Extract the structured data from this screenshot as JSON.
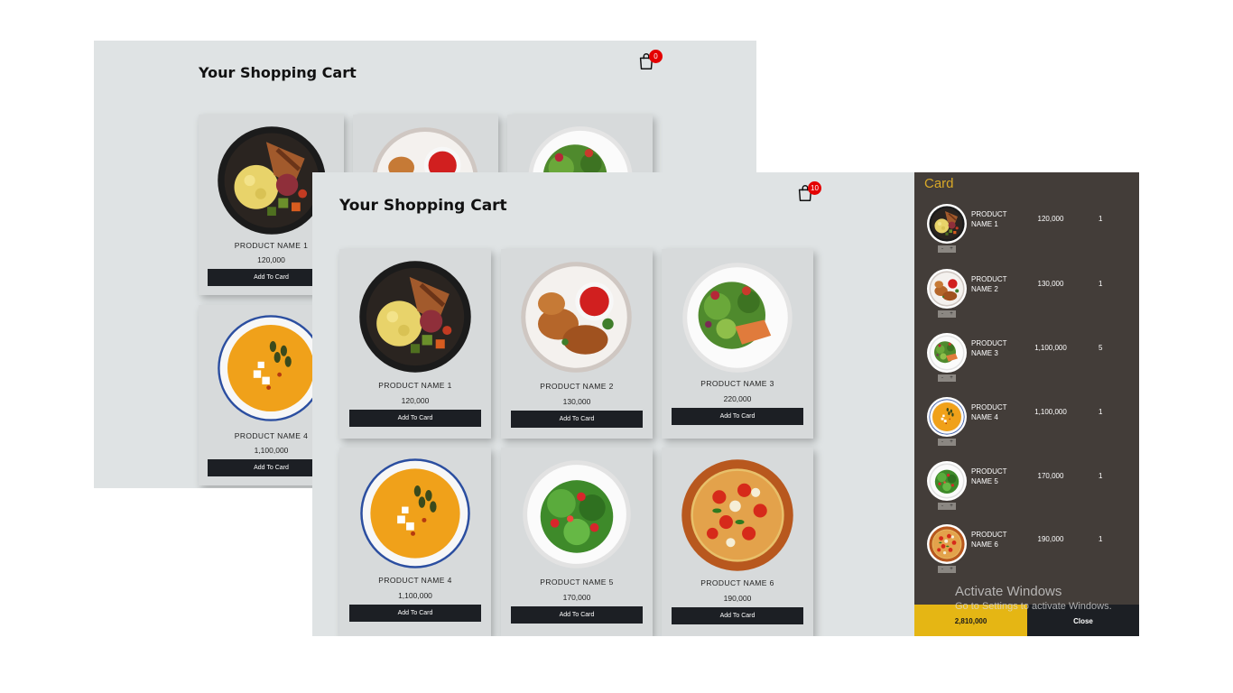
{
  "back_window": {
    "title": "Your Shopping Cart",
    "cart_count": "0",
    "products": [
      {
        "name": "PRODUCT NAME 1",
        "price": "120,000",
        "button": "Add To Card"
      },
      {
        "name": "PRODUCT NAME 4",
        "price": "1,100,000",
        "button": "Add To Card"
      }
    ]
  },
  "front_window": {
    "title": "Your Shopping Cart",
    "cart_count": "10",
    "products": [
      {
        "name": "PRODUCT NAME 1",
        "price": "120,000",
        "button": "Add To Card",
        "image": "bowl-icon"
      },
      {
        "name": "PRODUCT NAME 2",
        "price": "130,000",
        "button": "Add To Card",
        "image": "chicken-plate-icon"
      },
      {
        "name": "PRODUCT NAME 3",
        "price": "220,000",
        "button": "Add To Card",
        "image": "salmon-salad-icon"
      },
      {
        "name": "PRODUCT NAME 4",
        "price": "1,100,000",
        "button": "Add To Card",
        "image": "soup-icon"
      },
      {
        "name": "PRODUCT NAME 5",
        "price": "170,000",
        "button": "Add To Card",
        "image": "green-salad-icon"
      },
      {
        "name": "PRODUCT NAME 6",
        "price": "190,000",
        "button": "Add To Card",
        "image": "pizza-icon"
      }
    ]
  },
  "sidebar": {
    "title": "Card",
    "items": [
      {
        "name": "PRODUCT NAME 1",
        "price": "120,000",
        "qty": "1",
        "minus": "-",
        "plus": "+"
      },
      {
        "name": "PRODUCT NAME 2",
        "price": "130,000",
        "qty": "1",
        "minus": "-",
        "plus": "+"
      },
      {
        "name": "PRODUCT NAME 3",
        "price": "1,100,000",
        "qty": "5",
        "minus": "-",
        "plus": "+"
      },
      {
        "name": "PRODUCT NAME 4",
        "price": "1,100,000",
        "qty": "1",
        "minus": "-",
        "plus": "+"
      },
      {
        "name": "PRODUCT NAME 5",
        "price": "170,000",
        "qty": "1",
        "minus": "-",
        "plus": "+"
      },
      {
        "name": "PRODUCT NAME 6",
        "price": "190,000",
        "qty": "1",
        "minus": "-",
        "plus": "+"
      }
    ],
    "total": "2,810,000",
    "close_label": "Close"
  },
  "watermark": {
    "line1": "Activate Windows",
    "line2": "Go to Settings to activate Windows."
  },
  "colors": {
    "page_bg": "#dfe3e4",
    "card_bg": "#d7dadb",
    "button_bg": "#1c1f24",
    "sidebar_bg": "#433d39",
    "sidebar_title": "#d9a928",
    "total_bg": "#e5b614",
    "badge": "#e40000"
  }
}
